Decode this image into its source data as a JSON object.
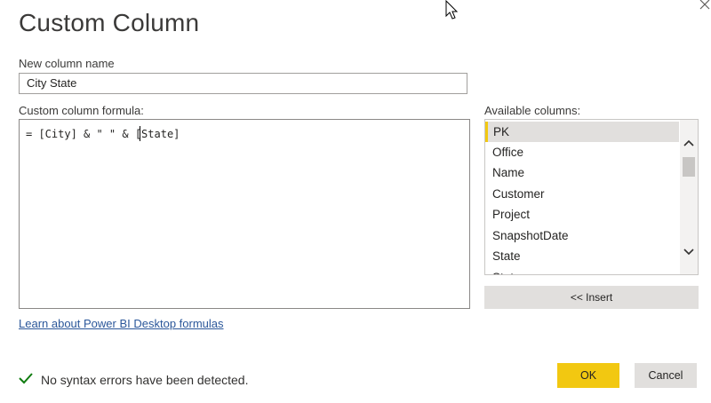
{
  "dialog": {
    "title": "Custom Column"
  },
  "name_field": {
    "label": "New column name",
    "value": "City State"
  },
  "formula": {
    "label": "Custom column formula:",
    "text": "= [City] & \" \" & [State]"
  },
  "available": {
    "label": "Available columns:",
    "items": [
      "PK",
      "Office",
      "Name",
      "Customer",
      "Project",
      "SnapshotDate",
      "State",
      "State"
    ],
    "selected": "PK"
  },
  "insert_label": "<< Insert",
  "learn_link": "Learn about Power BI Desktop formulas",
  "status": "No syntax errors have been detected.",
  "buttons": {
    "ok": "OK",
    "cancel": "Cancel"
  },
  "colors": {
    "accent": "#f2c811",
    "success": "#107c10",
    "link": "#2b579a"
  }
}
